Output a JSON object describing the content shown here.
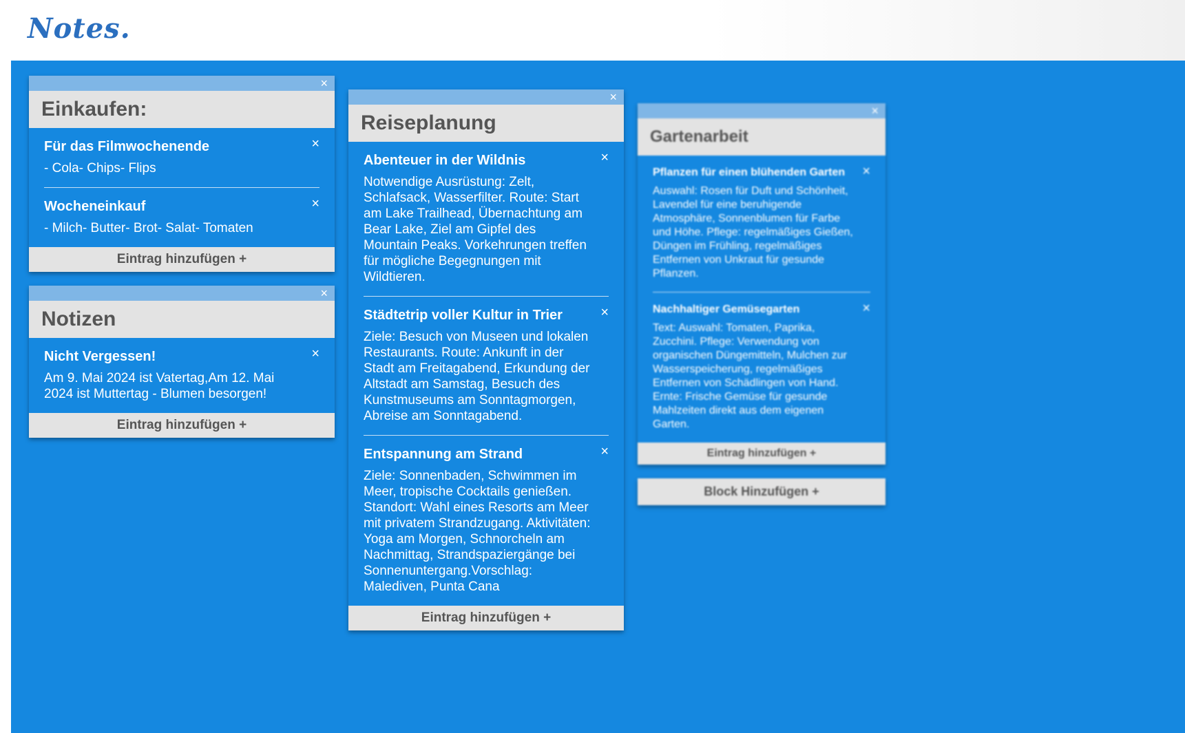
{
  "app": {
    "logo": "Notes."
  },
  "columns": [
    {
      "blocks": [
        {
          "title": "Einkaufen:",
          "close_icon": "×",
          "entries": [
            {
              "title": "Für das Filmwochenende",
              "text": "- Cola- Chips- Flips"
            },
            {
              "title": "Wocheneinkauf",
              "text": "- Milch- Butter- Brot- Salat- Tomaten"
            }
          ],
          "add_label": "Eintrag hinzufügen +"
        },
        {
          "title": "Notizen",
          "close_icon": "×",
          "entries": [
            {
              "title": "Nicht Vergessen!",
              "text": "Am 9. Mai 2024 ist Vatertag,Am 12. Mai 2024 ist Muttertag - Blumen besorgen!"
            }
          ],
          "add_label": "Eintrag hinzufügen +"
        }
      ]
    },
    {
      "blocks": [
        {
          "title": "Reiseplanung",
          "close_icon": "×",
          "entries": [
            {
              "title": "Abenteuer in der Wildnis",
              "text": "Notwendige Ausrüstung: Zelt, Schlafsack, Wasserfilter. Route: Start am Lake Trailhead, Übernachtung am Bear Lake, Ziel am Gipfel des Mountain Peaks. Vorkehrungen treffen für mögliche Begegnungen mit Wildtieren."
            },
            {
              "title": "Städtetrip voller Kultur in Trier",
              "text": "Ziele: Besuch von Museen und lokalen Restaurants. Route: Ankunft in der Stadt am Freitagabend, Erkundung der Altstadt am Samstag, Besuch des Kunstmuseums am Sonntagmorgen, Abreise am Sonntagabend."
            },
            {
              "title": "Entspannung am Strand",
              "text": "Ziele: Sonnenbaden, Schwimmen im Meer, tropische Cocktails genießen. Standort: Wahl eines Resorts am Meer mit privatem Strandzugang. Aktivitäten: Yoga am Morgen, Schnorcheln am Nachmittag, Strandspaziergänge bei Sonnenuntergang.Vorschlag: Malediven, Punta Cana"
            }
          ],
          "add_label": "Eintrag hinzufügen +"
        }
      ]
    },
    {
      "blocks": [
        {
          "title": "Gartenarbeit",
          "close_icon": "×",
          "entries": [
            {
              "title": "Pflanzen für einen blühenden Garten",
              "text": "Auswahl: Rosen für Duft und Schönheit, Lavendel für eine beruhigende Atmosphäre, Sonnenblumen für Farbe und Höhe. Pflege: regelmäßiges Gießen, Düngen im Frühling, regelmäßiges Entfernen von Unkraut für gesunde Pflanzen."
            },
            {
              "title": "Nachhaltiger Gemüsegarten",
              "text": "Text: Auswahl: Tomaten, Paprika, Zucchini. Pflege: Verwendung von organischen Düngemitteln, Mulchen zur Wasserspeicherung, regelmäßiges Entfernen von Schädlingen von Hand. Ernte: Frische Gemüse für gesunde Mahlzeiten direkt aus dem eigenen Garten."
            }
          ],
          "add_label": "Eintrag hinzufügen +"
        }
      ],
      "add_block_label": "Block Hinzufügen +"
    }
  ]
}
